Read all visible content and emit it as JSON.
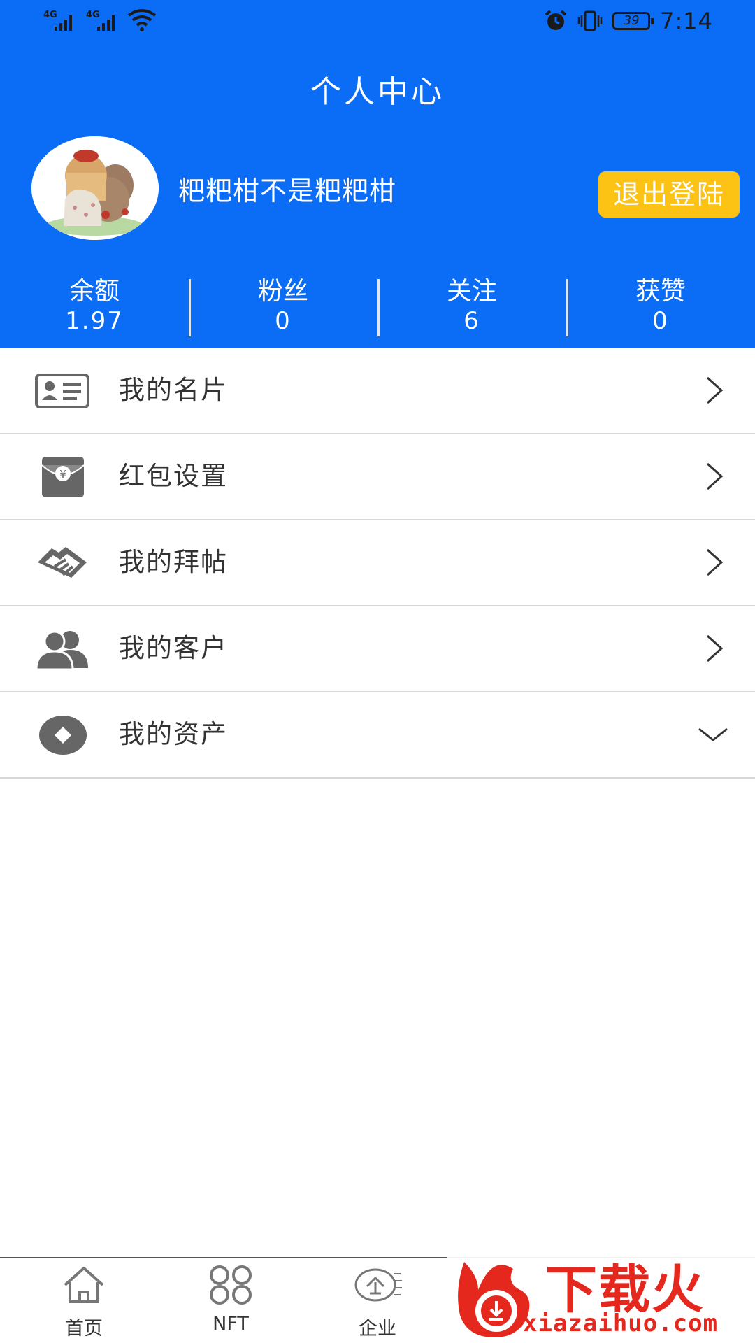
{
  "status_bar": {
    "network1": "4G",
    "network2": "4G",
    "battery": "39",
    "time": "7:14"
  },
  "header": {
    "title": "个人中心",
    "username": "粑粑柑不是粑粑柑",
    "logout_label": "退出登陆",
    "background_color": "#0b6cf6",
    "logout_color": "#fcc314"
  },
  "stats": [
    {
      "label": "余额",
      "value": "1.97"
    },
    {
      "label": "粉丝",
      "value": "0"
    },
    {
      "label": "关注",
      "value": "6"
    },
    {
      "label": "获赞",
      "value": "0"
    }
  ],
  "menu": [
    {
      "label": "我的名片",
      "icon": "business-card-icon",
      "indicator": "chevron-right-icon"
    },
    {
      "label": "红包设置",
      "icon": "red-envelope-icon",
      "indicator": "chevron-right-icon"
    },
    {
      "label": "我的拜帖",
      "icon": "handshake-icon",
      "indicator": "chevron-right-icon"
    },
    {
      "label": "我的客户",
      "icon": "customers-icon",
      "indicator": "chevron-right-icon"
    },
    {
      "label": "我的资产",
      "icon": "assets-icon",
      "indicator": "chevron-down-icon"
    }
  ],
  "tabbar": [
    {
      "label": "首页",
      "icon": "home-icon"
    },
    {
      "label": "NFT",
      "icon": "nft-icon"
    },
    {
      "label": "企业",
      "icon": "enterprise-icon"
    }
  ],
  "watermark": {
    "text": "下载火",
    "url": "xiazaihuo.com"
  }
}
